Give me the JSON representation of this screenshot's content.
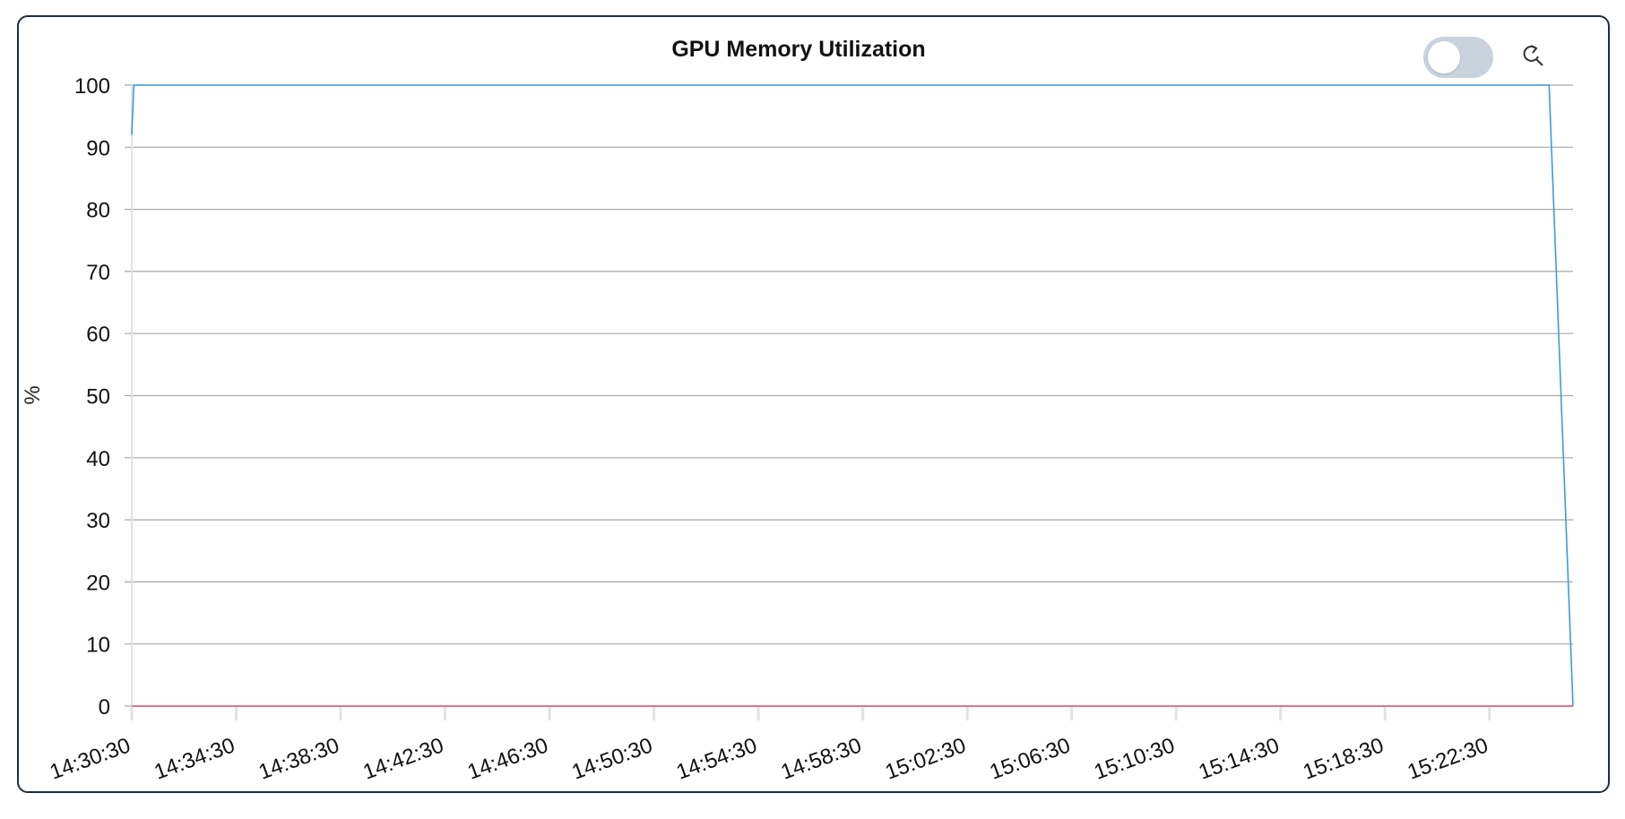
{
  "chart_data": {
    "type": "line",
    "title": "GPU Memory Utilization",
    "ylabel": "%",
    "xlabel": "",
    "ylim": [
      0,
      100
    ],
    "yticks": [
      0,
      10,
      20,
      30,
      40,
      50,
      60,
      70,
      80,
      90,
      100
    ],
    "x_range": [
      "14:30:30",
      "15:25:42"
    ],
    "x_ticks": [
      "14:30:30",
      "14:34:30",
      "14:38:30",
      "14:42:30",
      "14:46:30",
      "14:50:30",
      "14:54:30",
      "14:58:30",
      "15:02:30",
      "15:06:30",
      "15:10:30",
      "15:14:30",
      "15:18:30",
      "15:22:30"
    ],
    "grid": true,
    "legend": "none",
    "series": [
      {
        "color": "#3b9ddd",
        "points": [
          {
            "x": "14:30:30",
            "y": 92
          },
          {
            "x": "14:30:35",
            "y": 100
          },
          {
            "x": "15:24:47",
            "y": 100
          },
          {
            "x": "15:25:42",
            "y": 0
          }
        ]
      },
      {
        "color": "#e0506e",
        "points": [
          {
            "x": "14:30:30",
            "y": 0
          },
          {
            "x": "15:25:42",
            "y": 0
          }
        ]
      }
    ]
  },
  "controls": {
    "toggle_state": "off",
    "reset_zoom_icon": "reset-zoom-icon"
  },
  "colors": {
    "border": "#1f2d3d",
    "grid": "#a7a7a7",
    "axis": "#e2e2e2",
    "toggle_track": "#c9d3dd"
  }
}
